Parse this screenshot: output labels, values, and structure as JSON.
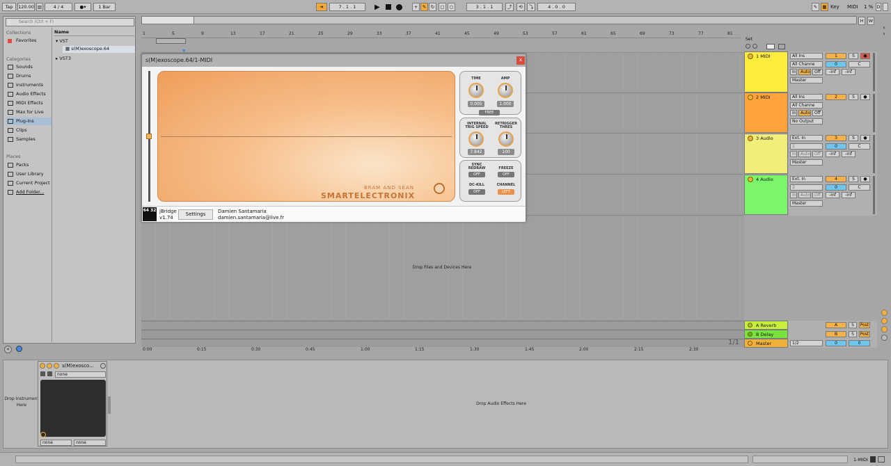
{
  "transport": {
    "tap": "Tap",
    "tempo": "120.00",
    "signature": "4 / 4",
    "quantize": "1 Bar",
    "arrangement_position": "7 .  1 .  1",
    "loop_start": "3 .  1 .  1",
    "loop_length": "4 .  0 .  0",
    "key_label": "Key",
    "midi_label": "MIDI",
    "cpu": "1 %",
    "d_label": "D"
  },
  "browser": {
    "search_placeholder": "Search (Ctrl + F)",
    "collections_header": "Collections",
    "favorites": "Favorites",
    "categories_header": "Categories",
    "categories": [
      "Sounds",
      "Drums",
      "Instruments",
      "Audio Effects",
      "MIDI Effects",
      "Max for Live",
      "Plug-Ins",
      "Clips",
      "Samples"
    ],
    "places_header": "Places",
    "places": [
      "Packs",
      "User Library",
      "Current Project",
      "Add Folder..."
    ],
    "name_header": "Name",
    "tree": [
      "VST",
      "s(M)exoscope.64",
      "VST3"
    ]
  },
  "ruler": {
    "bars": [
      "1",
      "5",
      "9",
      "13",
      "17",
      "21",
      "25",
      "29",
      "33",
      "37",
      "41",
      "45",
      "49",
      "53",
      "57",
      "61",
      "65",
      "69",
      "73",
      "77",
      "81"
    ],
    "times": [
      "0:00",
      "0:15",
      "0:30",
      "0:45",
      "1:00",
      "1:15",
      "1:30",
      "1:45",
      "2:00",
      "2:15",
      "2:30"
    ],
    "set_label": "Set",
    "h_label": "H",
    "w_label": "W"
  },
  "arrangement": {
    "drop_hint": "Drop Files and Devices Here",
    "page": "1/1"
  },
  "tracks": [
    {
      "name": "1 MIDI",
      "color": "#ffec3d",
      "input": "All Ins",
      "channel": "All Channe",
      "output": "Master",
      "num": "1",
      "vol": "0",
      "pan": "C"
    },
    {
      "name": "2 MIDI",
      "color": "#ffa33a",
      "input": "All Ins",
      "channel": "All Channe",
      "output": "No Output",
      "num": "2",
      "vol": "",
      "pan": ""
    },
    {
      "name": "3 Audio",
      "color": "#f1ef7a",
      "input": "Ext. In",
      "channel": "1",
      "output": "Master",
      "num": "3",
      "vol": "0",
      "pan": "C"
    },
    {
      "name": "4 Audio",
      "color": "#7cf56c",
      "input": "Ext. In",
      "channel": "2",
      "output": "Master",
      "num": "4",
      "vol": "0",
      "pan": "C"
    }
  ],
  "monitor": {
    "in": "In",
    "auto": "Auto",
    "off": "Off",
    "inf": "-inf",
    "s": "S"
  },
  "returns": [
    {
      "name": "A Reverb",
      "color": "#c8f03a",
      "num": "A",
      "post": "Post"
    },
    {
      "name": "B Delay",
      "color": "#79e33e",
      "num": "B",
      "post": "Post"
    },
    {
      "name": "Master",
      "color": "#f0b13a",
      "num": "0",
      "post": "0",
      "routing": "1/2"
    }
  ],
  "plugin": {
    "title": "s(M)exoscope.64/1-MIDI",
    "close": "x",
    "time_label": "TIME",
    "time_value": "0.005",
    "amp_label": "AMP",
    "amp_value": "1.000",
    "free": "FREE",
    "trig_label_1": "INTERNAL",
    "trig_label_2": "TRIG SPEED",
    "trig_value": "7.842",
    "retrig_label_1": "RETRIGGER",
    "retrig_label_2": "THRES",
    "retrig_value": "100",
    "sync_label_1": "SYNC",
    "sync_label_2": "REDRAW",
    "sync_value": "OFF",
    "freeze_label": "FREEZE",
    "freeze_value": "OFF",
    "dckill_label": "DC-KILL",
    "dckill_value": "OFF",
    "channel_label": "CHANNEL",
    "channel_value": "LEFT",
    "brand_top": "BRAM AND SEAN",
    "brand_main": "SMARTELECTRONIX",
    "bridge_name": "jBridge",
    "bridge_version": "v1.74",
    "settings": "Settings",
    "author": "Damien Santamaria",
    "email": "damien.santamaria@live.fr",
    "logo_text": "64 32"
  },
  "device": {
    "title": "s(M)exosco...",
    "preset": "none",
    "left_select": "none",
    "right_select": "none"
  },
  "detail": {
    "drop_instrument": "Drop Instrument Here",
    "drop_audio": "Drop Audio Effects Here",
    "status_track": "1-MIDI"
  }
}
